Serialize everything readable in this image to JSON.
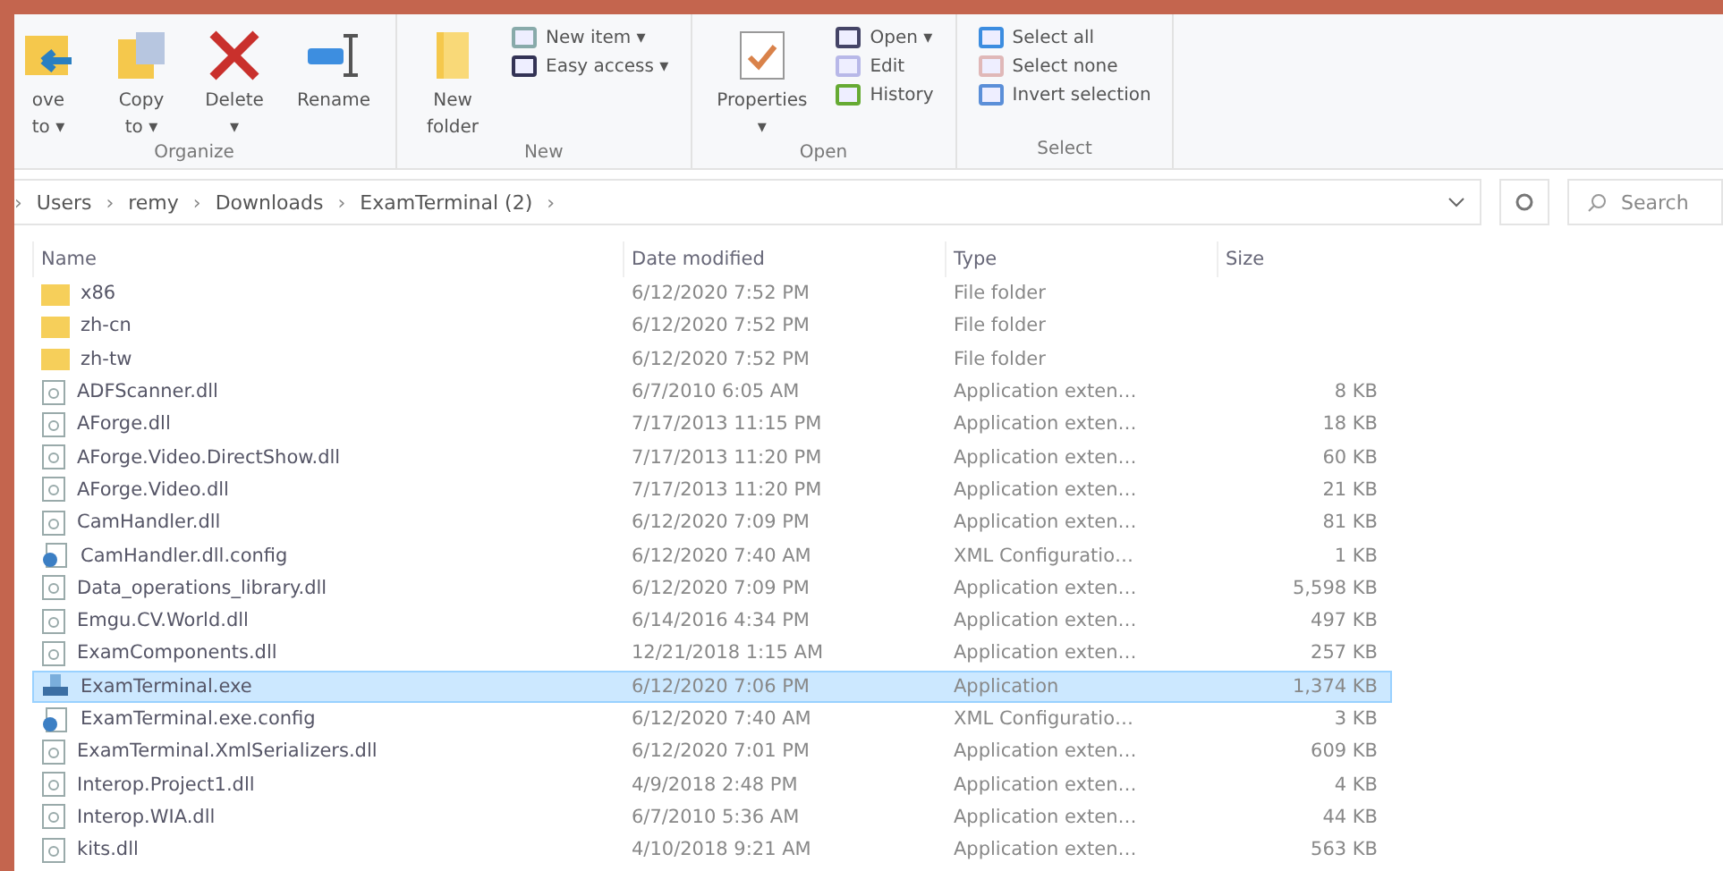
{
  "ribbon": {
    "groups": [
      {
        "label": "Organize",
        "big": [
          {
            "lines": [
              "ove",
              "to ▾"
            ]
          },
          {
            "lines": [
              "Copy",
              "to ▾"
            ]
          },
          {
            "lines": [
              "Delete",
              "▾"
            ]
          },
          {
            "lines": [
              "Rename"
            ]
          }
        ]
      },
      {
        "label": "New",
        "big": [
          {
            "lines": [
              "New",
              "folder"
            ]
          }
        ],
        "small": [
          {
            "label": "New item ▾"
          },
          {
            "label": "Easy access ▾"
          }
        ]
      },
      {
        "label": "Open",
        "big": [
          {
            "lines": [
              "Properties",
              "▾"
            ]
          }
        ],
        "small": [
          {
            "label": "Open ▾"
          },
          {
            "label": "Edit"
          },
          {
            "label": "History"
          }
        ]
      },
      {
        "label": "Select",
        "small": [
          {
            "label": "Select all"
          },
          {
            "label": "Select none"
          },
          {
            "label": "Invert selection"
          }
        ]
      }
    ]
  },
  "address": {
    "parts": [
      {
        "kind": "sep",
        "text": "›"
      },
      {
        "kind": "crumb",
        "text": "Users"
      },
      {
        "kind": "sep",
        "text": "›"
      },
      {
        "kind": "crumb",
        "text": "remy"
      },
      {
        "kind": "sep",
        "text": "›"
      },
      {
        "kind": "crumb",
        "text": "Downloads"
      },
      {
        "kind": "sep",
        "text": "›"
      },
      {
        "kind": "crumb",
        "text": "ExamTerminal (2)"
      },
      {
        "kind": "sep",
        "text": "›"
      }
    ]
  },
  "search": {
    "placeholder": "Search"
  },
  "table": {
    "columns": [
      "Name",
      "Date modified",
      "Type",
      "Size"
    ],
    "rows": [
      {
        "name": "x86",
        "date": "6/12/2020 7:52 PM",
        "type": "File folder",
        "size": "",
        "kind": "folder",
        "selected": false
      },
      {
        "name": "zh-cn",
        "date": "6/12/2020 7:52 PM",
        "type": "File folder",
        "size": "",
        "kind": "folder",
        "selected": false
      },
      {
        "name": "zh-tw",
        "date": "6/12/2020 7:52 PM",
        "type": "File folder",
        "size": "",
        "kind": "folder",
        "selected": false
      },
      {
        "name": "ADFScanner.dll",
        "date": "6/7/2010 6:05 AM",
        "type": "Application exten…",
        "size": "8 KB",
        "kind": "dll",
        "selected": false
      },
      {
        "name": "AForge.dll",
        "date": "7/17/2013 11:15 PM",
        "type": "Application exten…",
        "size": "18 KB",
        "kind": "dll",
        "selected": false
      },
      {
        "name": "AForge.Video.DirectShow.dll",
        "date": "7/17/2013 11:20 PM",
        "type": "Application exten…",
        "size": "60 KB",
        "kind": "dll",
        "selected": false
      },
      {
        "name": "AForge.Video.dll",
        "date": "7/17/2013 11:20 PM",
        "type": "Application exten…",
        "size": "21 KB",
        "kind": "dll",
        "selected": false
      },
      {
        "name": "CamHandler.dll",
        "date": "6/12/2020 7:09 PM",
        "type": "Application exten…",
        "size": "81 KB",
        "kind": "dll",
        "selected": false
      },
      {
        "name": "CamHandler.dll.config",
        "date": "6/12/2020 7:40 AM",
        "type": "XML Configuratio…",
        "size": "1 KB",
        "kind": "config",
        "selected": false
      },
      {
        "name": "Data_operations_library.dll",
        "date": "6/12/2020 7:09 PM",
        "type": "Application exten…",
        "size": "5,598 KB",
        "kind": "dll",
        "selected": false
      },
      {
        "name": "Emgu.CV.World.dll",
        "date": "6/14/2016 4:34 PM",
        "type": "Application exten…",
        "size": "497 KB",
        "kind": "dll",
        "selected": false
      },
      {
        "name": "ExamComponents.dll",
        "date": "12/21/2018 1:15 AM",
        "type": "Application exten…",
        "size": "257 KB",
        "kind": "dll",
        "selected": false
      },
      {
        "name": "ExamTerminal.exe",
        "date": "6/12/2020 7:06 PM",
        "type": "Application",
        "size": "1,374 KB",
        "kind": "exe",
        "selected": true
      },
      {
        "name": "ExamTerminal.exe.config",
        "date": "6/12/2020 7:40 AM",
        "type": "XML Configuratio…",
        "size": "3 KB",
        "kind": "config",
        "selected": false
      },
      {
        "name": "ExamTerminal.XmlSerializers.dll",
        "date": "6/12/2020 7:01 PM",
        "type": "Application exten…",
        "size": "609 KB",
        "kind": "dll",
        "selected": false
      },
      {
        "name": "Interop.Project1.dll",
        "date": "4/9/2018 2:48 PM",
        "type": "Application exten…",
        "size": "4 KB",
        "kind": "dll",
        "selected": false
      },
      {
        "name": "Interop.WIA.dll",
        "date": "6/7/2010 5:36 AM",
        "type": "Application exten…",
        "size": "44 KB",
        "kind": "dll",
        "selected": false
      },
      {
        "name": "kits.dll",
        "date": "4/10/2018 9:21 AM",
        "type": "Application exten…",
        "size": "563 KB",
        "kind": "dll",
        "selected": false
      }
    ]
  }
}
